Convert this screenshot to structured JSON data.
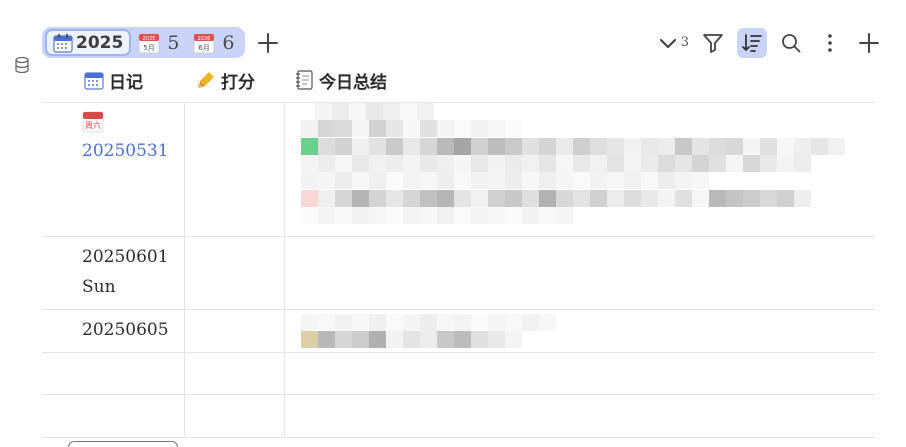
{
  "colors": {
    "accent": "#4a6fd6",
    "tab_group_bg": "#c9d3f7",
    "active_tool_bg": "#c9d3f7",
    "border": "#e4e4e4"
  },
  "view_tabs": [
    {
      "label": "2025",
      "icon": "calendar-icon",
      "active": true
    },
    {
      "label": "5",
      "icon": "calendar-page-icon",
      "icon_month": "5月",
      "icon_year": "2025"
    },
    {
      "label": "6",
      "icon": "calendar-page-icon",
      "icon_month": "6月",
      "icon_year": "2026"
    }
  ],
  "toolbar": {
    "group_count": "3",
    "icons": [
      "chevron-down-icon",
      "filter-icon",
      "sort-icon",
      "search-icon",
      "more-icon",
      "add-icon"
    ]
  },
  "columns": [
    {
      "label": "日记",
      "icon": "calendar-icon"
    },
    {
      "label": "打分",
      "icon": "writing-hand-icon"
    },
    {
      "label": "今日总结",
      "icon": "notebook-icon"
    }
  ],
  "rows": [
    {
      "date": "20250531",
      "weekday_icon_label": "周六",
      "linked": true,
      "summary_redacted": true
    },
    {
      "date": "20250601",
      "weekday": "Sun",
      "linked": false,
      "summary_redacted": false
    },
    {
      "date": "20250605",
      "linked": false,
      "summary_redacted": true
    },
    {
      "date": "",
      "linked": false
    },
    {
      "date": "",
      "linked": false
    }
  ]
}
